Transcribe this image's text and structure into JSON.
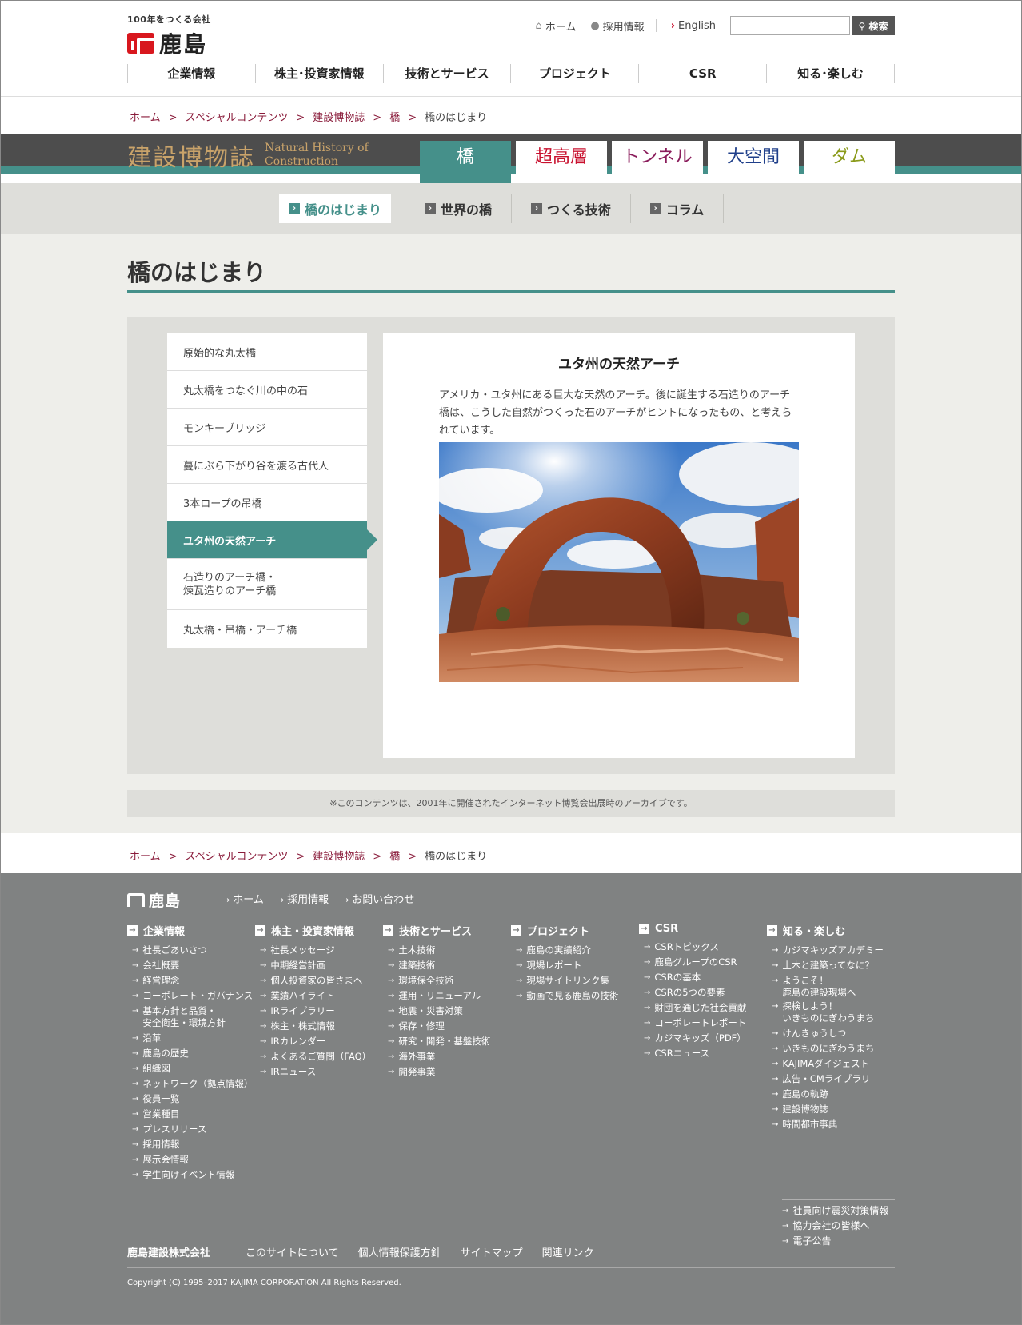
{
  "header": {
    "logo_tagline": "100年をつくる会社",
    "logo_text": "鹿島",
    "util": {
      "home": "ホーム",
      "recruit": "採用情報",
      "english": "English",
      "search_button": "検索",
      "search_placeholder": ""
    },
    "gnav": [
      "企業情報",
      "株主･投資家情報",
      "技術とサービス",
      "プロジェクト",
      "CSR",
      "知る･楽しむ"
    ]
  },
  "breadcrumb": {
    "items": [
      "ホーム",
      "スペシャルコンテンツ",
      "建設博物誌",
      "橋"
    ],
    "current": "橋のはじまり"
  },
  "museum": {
    "title": "建設博物誌",
    "title_en_1": "Natural History of",
    "title_en_2": "Construction",
    "tabs": [
      {
        "label": "橋",
        "color": "#ffffff"
      },
      {
        "label": "超高層",
        "color": "#c8102e"
      },
      {
        "label": "トンネル",
        "color": "#8a1c5b"
      },
      {
        "label": "大空間",
        "color": "#1f3f8a"
      },
      {
        "label": "ダム",
        "color": "#8a9a1a"
      }
    ]
  },
  "subnav": [
    "橋のはじまり",
    "世界の橋",
    "つくる技術",
    "コラム"
  ],
  "page_title": "橋のはじまり",
  "side_menu": [
    "原始的な丸太橋",
    "丸太橋をつなぐ川の中の石",
    "モンキーブリッジ",
    "蔓にぶら下がり谷を渡る古代人",
    "3本ロープの吊橋",
    "ユタ州の天然アーチ",
    "石造りのアーチ橋・",
    "煉瓦造りのアーチ橋",
    "丸太橋・吊橋・アーチ橋"
  ],
  "article": {
    "heading": "ユタ州の天然アーチ",
    "body": "アメリカ・ユタ州にある巨大な天然のアーチ。後に誕生する石造りのアーチ橋は、こうした自然がつくった石のアーチがヒントになったもの、と考えられています。"
  },
  "note": "※このコンテンツは、2001年に開催されたインターネット博覧会出展時のアーカイブです。",
  "footer": {
    "logo": "鹿島",
    "top_links": [
      "ホーム",
      "採用情報",
      "お問い合わせ"
    ],
    "columns": [
      {
        "title": "企業情報",
        "items": [
          "社長ごあいさつ",
          "会社概要",
          "経営理念",
          "コーポレート・ガバナンス",
          "基本方針と品質・",
          "安全衛生・環境方針",
          "沿革",
          "鹿島の歴史",
          "組織図",
          "ネットワーク（拠点情報）",
          "役員一覧",
          "営業種目",
          "プレスリリース",
          "採用情報",
          "展示会情報",
          "学生向けイベント情報"
        ]
      },
      {
        "title": "株主・投資家情報",
        "items": [
          "社長メッセージ",
          "中期経営計画",
          "個人投資家の皆さまへ",
          "業績ハイライト",
          "IRライブラリー",
          "株主・株式情報",
          "IRカレンダー",
          "よくあるご質問（FAQ）",
          "IRニュース"
        ]
      },
      {
        "title": "技術とサービス",
        "items": [
          "土木技術",
          "建築技術",
          "環境保全技術",
          "運用・リニューアル",
          "地震・災害対策",
          "保存・修理",
          "研究・開発・基盤技術",
          "海外事業",
          "開発事業"
        ]
      },
      {
        "title": "プロジェクト",
        "items": [
          "鹿島の実績紹介",
          "現場レポート",
          "現場サイトリンク集",
          "動画で見る鹿島の技術"
        ]
      },
      {
        "title": "CSR",
        "items": [
          "CSRトピックス",
          "鹿島グループのCSR",
          "CSRの基本",
          "CSRの5つの要素",
          "財団を通じた社会貢献",
          "コーポレートレポート",
          "カジマキッズ（PDF）",
          "CSRニュース"
        ]
      },
      {
        "title": "知る・楽しむ",
        "items": [
          "カジマキッズアカデミー",
          "土木と建築ってなに？",
          "ようこそ！",
          "鹿島の建設現場へ",
          "探検しよう！",
          "いきものにぎわうまち",
          "けんきゅうしつ",
          "いきものにぎわうまち",
          "KAJIMAダイジェスト",
          "広告・CMライブラリ",
          "鹿島の軌跡",
          "建設博物誌",
          "時間都市事典"
        ]
      }
    ],
    "extra_links": [
      "社員向け震災対策情報",
      "協力会社の皆様へ",
      "電子公告"
    ],
    "corp_name": "鹿島建設株式会社",
    "bottom_links": [
      "このサイトについて",
      "個人情報保護方針",
      "サイトマップ",
      "関連リンク"
    ],
    "copyright": "Copyright (C) 1995–2017 KAJIMA CORPORATION All Rights Reserved."
  }
}
